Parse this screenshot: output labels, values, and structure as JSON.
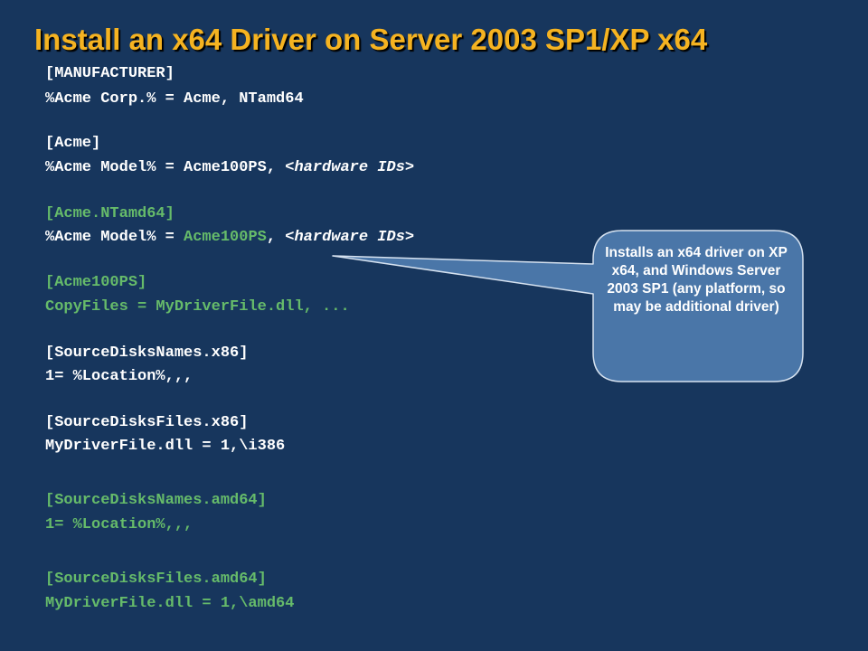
{
  "slide": {
    "title": "Install an x64 Driver on Server 2003 SP1/XP x64"
  },
  "code": {
    "manufacturer_header": "[MANUFACTURER]",
    "manufacturer_line": "%Acme Corp.% = Acme, NTamd64",
    "acme_header": "[Acme]",
    "acme_line_prefix": "%Acme Model% = Acme100PS, ",
    "acme_line_hwids": "<hardware IDs>",
    "acme_ntamd64_header": "[Acme.NTamd64]",
    "acme_ntamd64_line_prefix": "%Acme Model% = ",
    "acme_ntamd64_line_section": "Acme100PS",
    "acme_ntamd64_line_sep": ", ",
    "acme_ntamd64_line_hwids": "<hardware IDs>",
    "acme100ps_header": "[Acme100PS]",
    "acme100ps_line": "CopyFiles = MyDriverFile.dll, ...",
    "sdn_x86_header": "[SourceDisksNames.x86]",
    "sdn_x86_line": "1= %Location%,,,",
    "sdf_x86_header": "[SourceDisksFiles.x86]",
    "sdf_x86_line": "MyDriverFile.dll = 1,\\i386",
    "sdn_amd64_header": "[SourceDisksNames.amd64]",
    "sdn_amd64_line": "1= %Location%,,,",
    "sdf_amd64_header": "[SourceDisksFiles.amd64]",
    "sdf_amd64_line": "MyDriverFile.dll = 1,\\amd64"
  },
  "callout": {
    "text": "Installs an x64 driver on XP x64, and Windows Server 2003 SP1 (any platform, so may be additional driver)"
  },
  "colors": {
    "background": "#17365d",
    "title": "#f5b321",
    "code_default": "#ffffff",
    "code_highlight": "#66bb6a",
    "callout_fill": "#4a76a8",
    "callout_border": "#d6e2f0"
  }
}
